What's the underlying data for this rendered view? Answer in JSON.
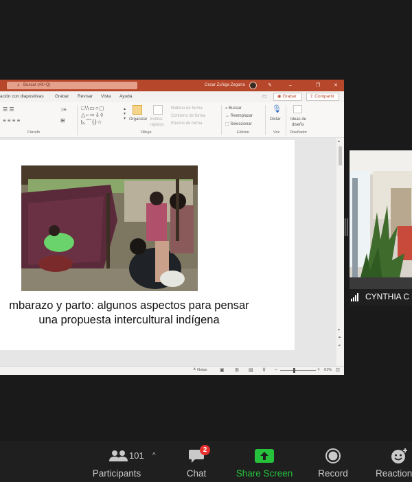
{
  "colors": {
    "ppt_brand": "#b7472a",
    "zoom_bg": "#1a1a1a",
    "share_green": "#26c23c",
    "badge_red": "#e8312f"
  },
  "ppt": {
    "search_placeholder": "Buscar (Alt+Q)",
    "user_name": "Cesar Zuñiga Zegarra",
    "menu": {
      "tab_slideshow": "ación con diapositivas",
      "tab_record": "Grabar",
      "tab_review": "Revisar",
      "tab_view": "Vista",
      "tab_help": "Ayuda",
      "record_button": "Grabar",
      "share_button": "Compartir"
    },
    "ribbon": {
      "paragraph_label": "Párrafo",
      "drawing_label": "Dibujo",
      "editing_label": "Edición",
      "voice_label": "Voz",
      "designer_label": "Diseñador",
      "organize": "Organizar",
      "quick_styles_1": "Estilos",
      "quick_styles_2": "rápidos",
      "shape_fill": "Relleno de forma",
      "shape_outline": "Contorno de forma",
      "shape_effects": "Efectos de forma",
      "find": "Buscar",
      "replace": "Reemplazar",
      "select": "Seleccionar",
      "dictate": "Dictar",
      "design_ideas_1": "Ideas de",
      "design_ideas_2": "diseño"
    },
    "slide": {
      "caption_line1": "mbarazo y parto: algunos aspectos para pensar",
      "caption_line2": "una propuesta intercultural indígena"
    },
    "status": {
      "notes": "Notas",
      "zoom": "61%"
    }
  },
  "participant_tile": {
    "name": "CYNTHIA C"
  },
  "toolbar": {
    "participants_label": "Participants",
    "participants_count": "101",
    "chat_label": "Chat",
    "chat_badge": "2",
    "share_label": "Share Screen",
    "record_label": "Record",
    "reactions_label": "Reactions"
  }
}
